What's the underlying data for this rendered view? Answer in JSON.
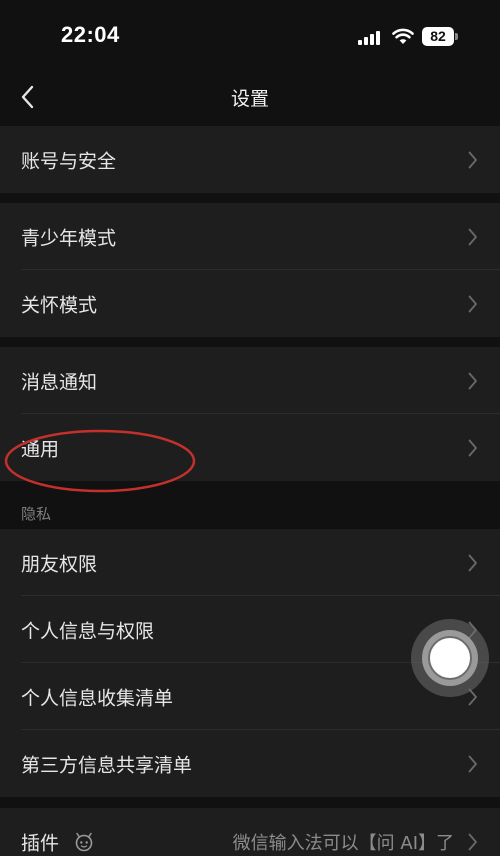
{
  "status_bar": {
    "time": "22:04",
    "battery": "82"
  },
  "nav": {
    "title": "设置"
  },
  "groups": {
    "account": [
      "账号与安全"
    ],
    "modes": [
      "青少年模式",
      "关怀模式"
    ],
    "general": [
      "消息通知",
      "通用"
    ],
    "privacy_header": "隐私",
    "privacy": [
      "朋友权限",
      "个人信息与权限",
      "个人信息收集清单",
      "第三方信息共享清单"
    ],
    "plugins": {
      "label": "插件",
      "subtitle": "微信输入法可以【问 AI】了"
    }
  },
  "colors": {
    "background": "#111111",
    "cell": "#1e1e1e",
    "annotation": "#c4302b"
  },
  "icons": [
    "back-chevron-icon",
    "chevron-right-icon",
    "signal-icon",
    "wifi-icon",
    "battery-icon",
    "plugin-bot-icon",
    "assistive-touch-icon"
  ]
}
